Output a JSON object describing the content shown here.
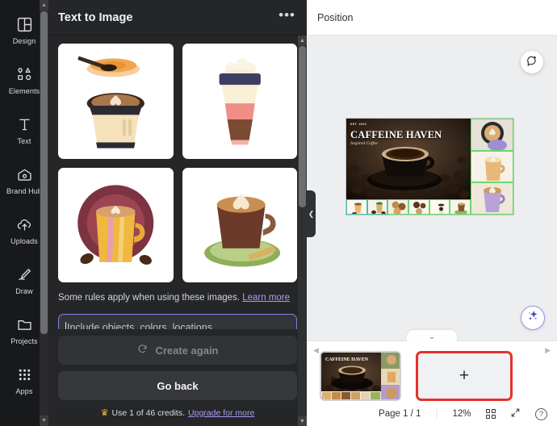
{
  "sidebar": {
    "items": [
      {
        "label": "Design",
        "icon": "design-icon"
      },
      {
        "label": "Elements",
        "icon": "elements-icon"
      },
      {
        "label": "Text",
        "icon": "text-icon"
      },
      {
        "label": "Brand Hub",
        "icon": "brand-hub-icon"
      },
      {
        "label": "Uploads",
        "icon": "uploads-icon"
      },
      {
        "label": "Draw",
        "icon": "draw-icon"
      },
      {
        "label": "Projects",
        "icon": "projects-icon"
      },
      {
        "label": "Apps",
        "icon": "apps-icon"
      }
    ]
  },
  "panel": {
    "title": "Text to Image",
    "more_menu": "•••",
    "results": [
      {
        "alt": "latte art coffee cup with pastry"
      },
      {
        "alt": "iced coffee cup with whipped cream"
      },
      {
        "alt": "yellow mug of latte with coffee beans"
      },
      {
        "alt": "latte art cup on green saucer"
      }
    ],
    "rules_text": "Some rules apply when using these images.",
    "rules_link": "Learn more",
    "prompt_placeholder": "Include objects, colors, locations,",
    "prompt_value": "",
    "create_again_label": "Create again",
    "create_again_icon": "refresh-icon",
    "go_back_label": "Go back",
    "credits_icon": "crown-icon",
    "credits_text": "Use 1 of 46 credits.",
    "credits_link": "Upgrade for more"
  },
  "toolbar": {
    "position_label": "Position"
  },
  "canvas": {
    "design": {
      "eyebrow": "EST. 2023",
      "title": "CAFFEINE HAVEN",
      "subtitle": "Inspired Coffee",
      "right_thumbs": 3,
      "bottom_thumbs": 6,
      "page_badge": "1"
    },
    "comment_button_icon": "add-comment-icon",
    "magic_button_icon": "magic-sparkle-icon"
  },
  "pagebar": {
    "prev_icon": "chevron-left-icon",
    "next_icon": "chevron-right-icon",
    "collapse_icon": "chevron-down-icon",
    "add_page_label": "+",
    "page_indicator": "Page 1 / 1",
    "zoom_level": "12%",
    "grid_icon": "grid-view-icon",
    "fullscreen_icon": "expand-icon",
    "help_icon": "help-icon",
    "help_glyph": "?"
  },
  "colors": {
    "rail_bg": "#18191b",
    "panel_bg": "#252627",
    "accent_purple": "#8b7cf0",
    "link_purple": "#a99cf5",
    "highlight_red": "#e8302a",
    "selection_green": "#66d96a",
    "selection_teal": "#43c2a8",
    "crown_gold": "#e9b949"
  }
}
